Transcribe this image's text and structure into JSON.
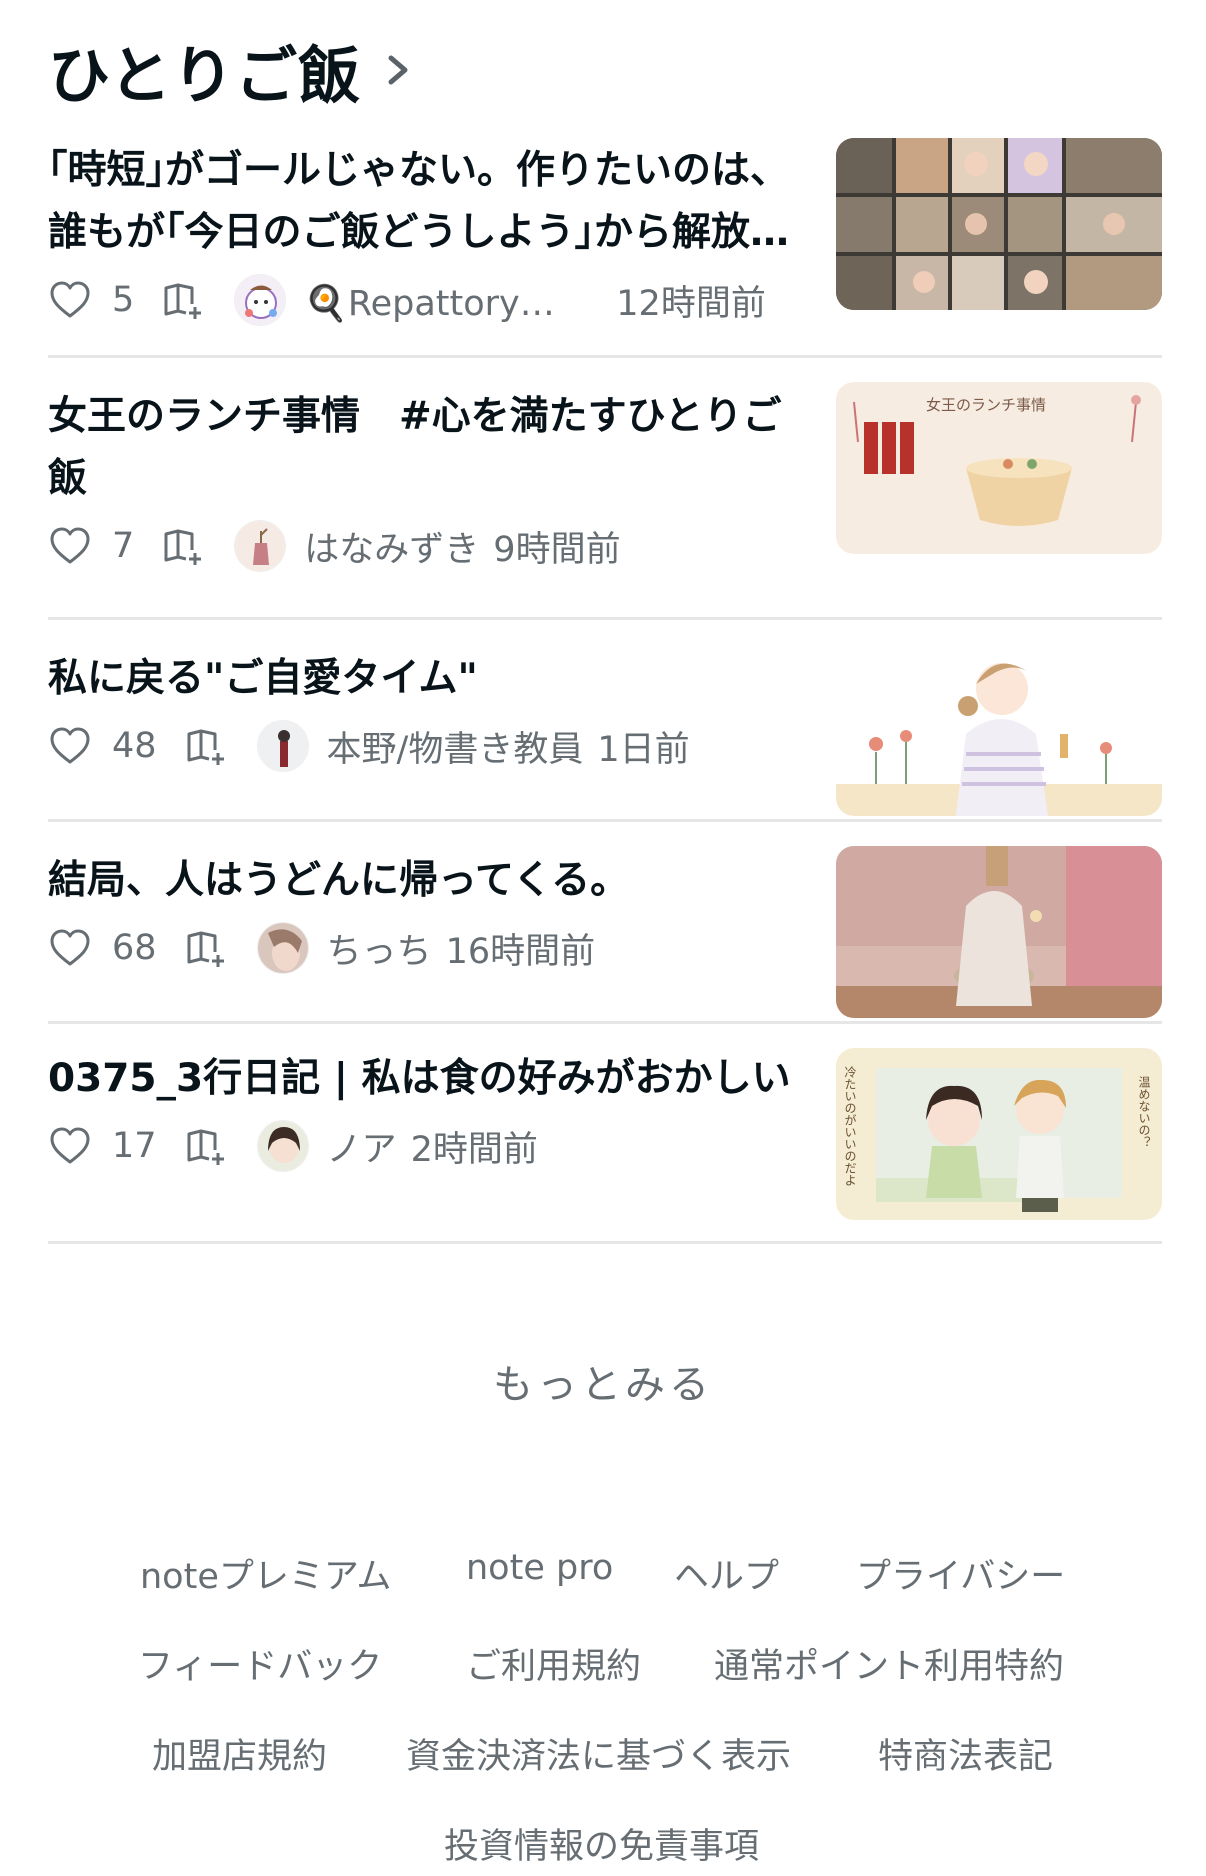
{
  "section": {
    "title": "ひとりご飯"
  },
  "articles": [
    {
      "title": "｢時短｣がゴールじゃない。作りたいのは、誰もが｢今日のご飯どうしよう｣から解放される未来",
      "likes": "5",
      "author": "🍳Repattory（レパトリー）",
      "time": "12時間前"
    },
    {
      "title": "女王のランチ事情　#心を満たすひとりご飯",
      "likes": "7",
      "author": "はなみずき",
      "time": "9時間前",
      "thumb_title": "女王のランチ事情"
    },
    {
      "title": "私に戻る\"ご自愛タイム\"",
      "likes": "48",
      "author": "本野/物書き教員",
      "time": "1日前"
    },
    {
      "title": "結局、人はうどんに帰ってくる。",
      "likes": "68",
      "author": "ちっち",
      "time": "16時間前"
    },
    {
      "title": "0375_3行日記 | 私は食の好みがおかしい",
      "likes": "17",
      "author": "ノア",
      "time": "2時間前",
      "thumb_text_left": "冷たいのがいいのだよ",
      "thumb_text_right": "温めないの？"
    }
  ],
  "more_label": "もっとみる",
  "footer": {
    "links": [
      "noteプレミアム",
      "note pro",
      "ヘルプ",
      "プライバシー",
      "フィードバック",
      "ご利用規約",
      "通常ポイント利用特約",
      "加盟店規約",
      "資金決済法に基づく表示",
      "特商法表記",
      "投資情報の免責事項"
    ]
  },
  "colors": {
    "text": "#08131a",
    "muted": "#666e73",
    "divider": "#e6e6e6"
  },
  "icons": [
    "chevron-right-icon",
    "heart-icon",
    "magazine-add-icon"
  ]
}
